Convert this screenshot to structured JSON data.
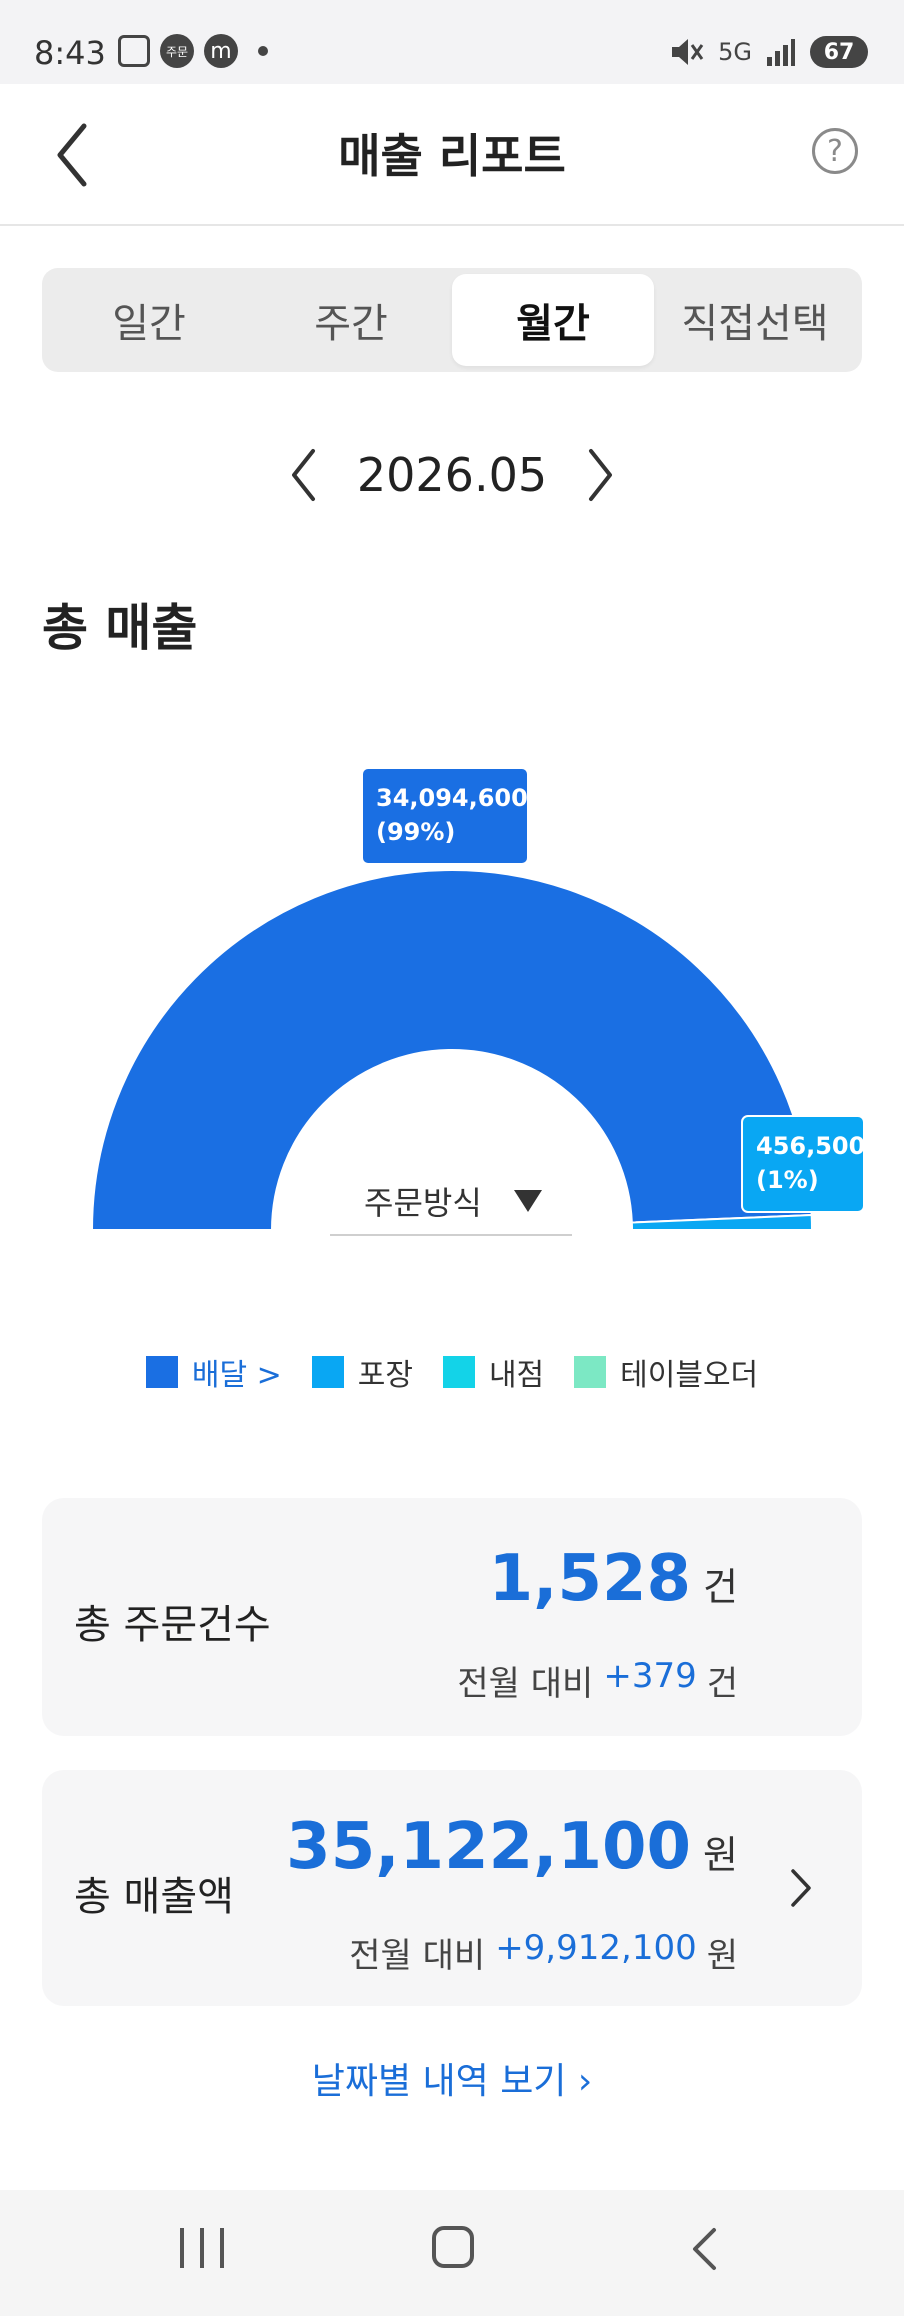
{
  "status_bar": {
    "time": "8:43",
    "order_badge": "주문",
    "app_badge": "m",
    "network": "5G",
    "battery": "67"
  },
  "header": {
    "title": "매출 리포트",
    "help_symbol": "?"
  },
  "tabs": [
    {
      "label": "일간",
      "active": false
    },
    {
      "label": "주간",
      "active": false
    },
    {
      "label": "월간",
      "active": true
    },
    {
      "label": "직접선택",
      "active": false
    }
  ],
  "period": {
    "label": "2026.05"
  },
  "section": {
    "title": "총 매출"
  },
  "chart_data": {
    "type": "pie",
    "style": "half-donut",
    "categories": [
      "배달",
      "포장",
      "내점",
      "테이블오더"
    ],
    "values": [
      34094600,
      456500,
      0,
      0
    ],
    "data_labels": [
      {
        "value": "34,094,600",
        "percent": "(99%)"
      },
      {
        "value": "456,500",
        "percent": "(1%)"
      }
    ],
    "colors": [
      "#1a6fe3",
      "#09a7f3",
      "#13d3e8",
      "#7ce8c4"
    ]
  },
  "dropdown": {
    "selected": "주문방식"
  },
  "legend": [
    {
      "label": "배달 >",
      "color": "#1a6fe3",
      "link": true
    },
    {
      "label": "포장",
      "color": "#09a7f3",
      "link": false
    },
    {
      "label": "내점",
      "color": "#13d3e8",
      "link": false
    },
    {
      "label": "테이블오더",
      "color": "#7ce8c4",
      "link": false
    }
  ],
  "cards": {
    "orders": {
      "label": "총 주문건수",
      "value": "1,528",
      "unit": "건",
      "compare_label": "전월 대비",
      "delta": "+379",
      "delta_unit": "건"
    },
    "sales": {
      "label": "총 매출액",
      "value": "35,122,100",
      "unit": "원",
      "compare_label": "전월 대비",
      "delta": "+9,912,100",
      "delta_unit": "원"
    }
  },
  "links": {
    "daily_history": "날짜별 내역 보기 ›"
  },
  "colors": {
    "accent": "#1a6ed8",
    "card_bg": "#f6f6f7"
  }
}
